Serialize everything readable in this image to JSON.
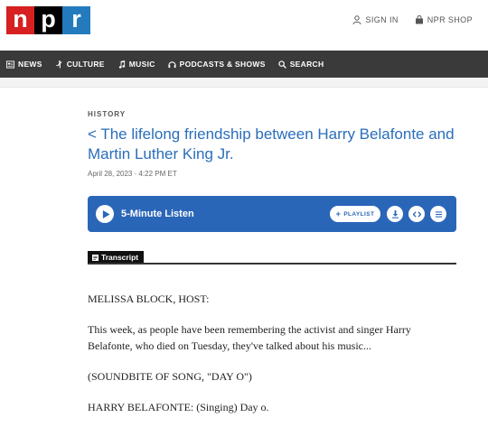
{
  "logo": {
    "letters": [
      "n",
      "p",
      "r"
    ]
  },
  "top_links": {
    "sign_in": "SIGN IN",
    "shop": "NPR SHOP"
  },
  "nav": {
    "items": [
      {
        "label": "NEWS",
        "icon": "news-icon"
      },
      {
        "label": "CULTURE",
        "icon": "culture-icon"
      },
      {
        "label": "MUSIC",
        "icon": "music-icon"
      },
      {
        "label": "PODCASTS & SHOWS",
        "icon": "headphones-icon"
      },
      {
        "label": "SEARCH",
        "icon": "search-icon"
      }
    ]
  },
  "article": {
    "slug": "HISTORY",
    "title": "< The lifelong friendship between Harry Belafonte and Martin Luther King Jr.",
    "date": "April 28, 2023 · 4:22 PM ET"
  },
  "player": {
    "listen_label": "5-Minute Listen",
    "playlist_label": "PLAYLIST",
    "accent": "#2a66b8"
  },
  "transcript": {
    "tab_label": "Transcript",
    "paragraphs": [
      "MELISSA BLOCK, HOST:",
      "This week, as people have been remembering the activist and singer Harry Belafonte, who died on Tuesday, they've talked about his music...",
      "(SOUNDBITE OF SONG, \"DAY O\")",
      "HARRY BELAFONTE: (Singing) Day o."
    ]
  },
  "colors": {
    "npr_red": "#d62021",
    "npr_black": "#000000",
    "npr_blue": "#237bbd",
    "nav_bg": "#3a3a3a",
    "title_blue": "#2a6ebb"
  }
}
